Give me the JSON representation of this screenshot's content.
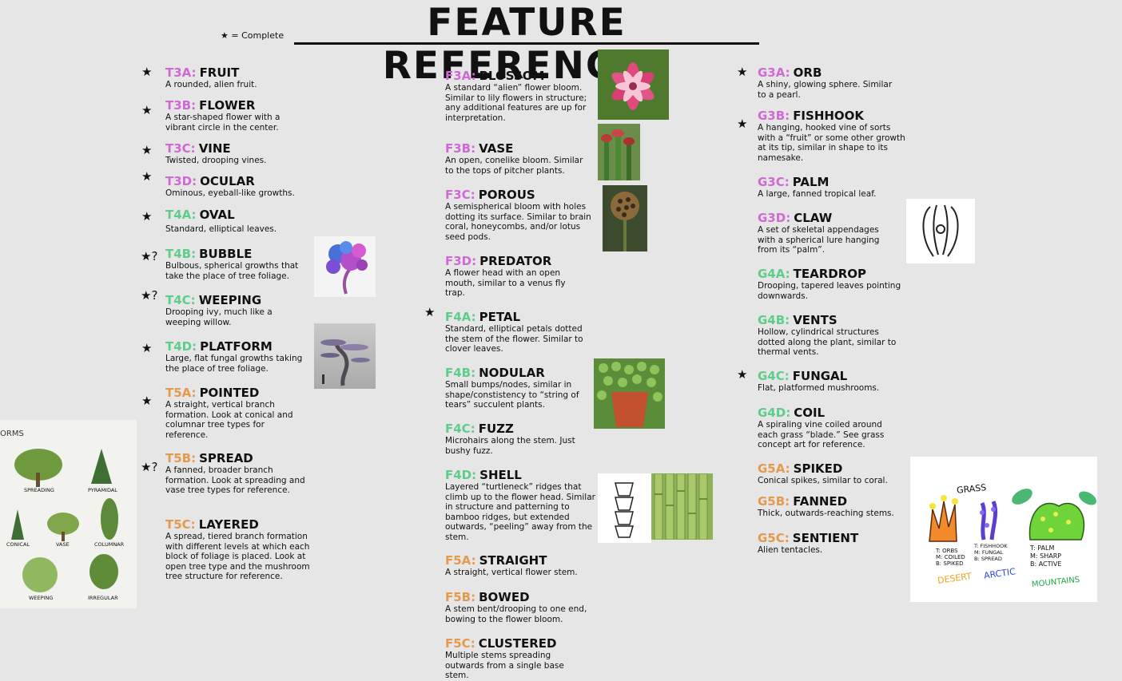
{
  "title": "FEATURE REFERENCES",
  "legend": "★ = Complete",
  "colors": {
    "pink": "#cf6ad4",
    "green": "#5fcd8a",
    "orange": "#e39a4c"
  },
  "col1": [
    {
      "code": "T3A:",
      "name": "FRUIT",
      "desc": "A rounded, alien fruit.",
      "star": "★"
    },
    {
      "code": "T3B:",
      "name": "FLOWER",
      "desc": "A star-shaped flower with a vibrant circle in the center.",
      "star": "★"
    },
    {
      "code": "T3C:",
      "name": "VINE",
      "desc": "Twisted, drooping vines.",
      "star": "★"
    },
    {
      "code": "T3D:",
      "name": "OCULAR",
      "desc": "Ominous, eyeball-like growths.",
      "star": "★"
    },
    {
      "code": "T4A:",
      "name": "OVAL",
      "desc": "Standard, elliptical leaves.",
      "star": "★"
    },
    {
      "code": "T4B:",
      "name": "BUBBLE",
      "desc": "Bulbous, spherical growths that take the place of tree foliage.",
      "star": "★?"
    },
    {
      "code": "T4C:",
      "name": "WEEPING",
      "desc": "Drooping ivy, much like a weeping willow.",
      "star": "★?"
    },
    {
      "code": "T4D:",
      "name": "PLATFORM",
      "desc": "Large, flat fungal growths taking the place of tree foliage.",
      "star": "★"
    },
    {
      "code": "T5A:",
      "name": "POINTED",
      "desc": "A straight, vertical branch formation. Look at conical and columnar tree types for reference.",
      "star": "★"
    },
    {
      "code": "T5B:",
      "name": "SPREAD",
      "desc": "A fanned, broader branch formation. Look at spreading and vase tree types for reference.",
      "star": "★?"
    },
    {
      "code": "T5C:",
      "name": "LAYERED",
      "desc": "A spread, tiered branch formation with different levels at which each block of foliage is placed. Look at open tree type and the mushroom tree structure for reference.",
      "star": ""
    }
  ],
  "col2": [
    {
      "code": "F3A:",
      "name": "BLOSSOM",
      "desc": "A standard “alien” flower bloom. Similar to lily flowers in structure; any additional features are up for interpretation.",
      "star": ""
    },
    {
      "code": "F3B:",
      "name": "VASE",
      "desc": "An open, conelike bloom. Similar to the tops of pitcher plants.",
      "star": ""
    },
    {
      "code": "F3C:",
      "name": "POROUS",
      "desc": "A semispherical bloom with holes dotting its surface. Similar to brain coral, honeycombs, and/or lotus seed pods.",
      "star": ""
    },
    {
      "code": "F3D:",
      "name": "PREDATOR",
      "desc": "A flower head with an open mouth, similar to a venus fly trap.",
      "star": ""
    },
    {
      "code": "F4A:",
      "name": "PETAL",
      "desc": "Standard, elliptical petals dotted the stem of the flower. Similar to clover leaves.",
      "star": "★"
    },
    {
      "code": "F4B:",
      "name": "NODULAR",
      "desc": "Small bumps/nodes, similar in shape/constistency to “string of tears” succulent plants.",
      "star": ""
    },
    {
      "code": "F4C:",
      "name": "FUZZ",
      "desc": "Microhairs along the stem. Just bushy fuzz.",
      "star": ""
    },
    {
      "code": "F4D:",
      "name": "SHELL",
      "desc": "Layered “turtleneck” ridges that climb up to the flower head. Similar in structure and patterning to bamboo ridges, but extended outwards, “peeling” away from the stem.",
      "star": ""
    },
    {
      "code": "F5A:",
      "name": "STRAIGHT",
      "desc": "A straight, vertical flower stem.",
      "star": ""
    },
    {
      "code": "F5B:",
      "name": "BOWED",
      "desc": "A stem bent/drooping to one end, bowing to the flower bloom.",
      "star": ""
    },
    {
      "code": "F5C:",
      "name": "CLUSTERED",
      "desc": "Multiple stems spreading outwards from a single base stem.",
      "star": ""
    }
  ],
  "col3": [
    {
      "code": "G3A:",
      "name": "ORB",
      "desc": "A shiny, glowing sphere. Similar to a pearl.",
      "star": "★"
    },
    {
      "code": "G3B:",
      "name": "FISHHOOK",
      "desc": "A hanging, hooked vine of sorts with a “fruit” or some other growth at its tip, similar in shape to its namesake.",
      "star": "★"
    },
    {
      "code": "G3C:",
      "name": "PALM",
      "desc": "A large, fanned tropical leaf.",
      "star": ""
    },
    {
      "code": "G3D:",
      "name": "CLAW",
      "desc": "A set of skeletal appendages with a spherical lure hanging from its “palm”.",
      "star": ""
    },
    {
      "code": "G4A:",
      "name": "TEARDROP",
      "desc": "Drooping, tapered leaves pointing downwards.",
      "star": ""
    },
    {
      "code": "G4B:",
      "name": "VENTS",
      "desc": "Hollow, cylindrical structures dotted along the plant, similar to thermal vents.",
      "star": ""
    },
    {
      "code": "G4C:",
      "name": "FUNGAL",
      "desc": "Flat, platformed mushrooms.",
      "star": "★"
    },
    {
      "code": "G4D:",
      "name": "COIL",
      "desc": "A spiraling vine coiled around each grass “blade.” See grass concept art for reference.",
      "star": ""
    },
    {
      "code": "G5A:",
      "name": "SPIKED",
      "desc": "Conical spikes, similar to coral.",
      "star": ""
    },
    {
      "code": "G5B:",
      "name": "FANNED",
      "desc": "Thick, outwards-reaching stems.",
      "star": ""
    },
    {
      "code": "G5C:",
      "name": "SENTIENT",
      "desc": "Alien tentacles.",
      "star": ""
    }
  ],
  "tree_forms": {
    "header": "ORMS",
    "labels": [
      "SPREADING",
      "PYRAMIDAL",
      "CONICAL",
      "VASE",
      "COLUMNAR",
      "WEEPING",
      "IRREGULAR"
    ]
  },
  "grass_art": {
    "title": "GRASS",
    "desert": {
      "lines": [
        "T: ORBS",
        "M: COILED",
        "B: SPIKED"
      ],
      "label": "DESERT"
    },
    "arctic": {
      "lines": [
        "T: FISHHOOK",
        "M: FUNGAL",
        "B: SPREAD"
      ],
      "label": "ARCTIC"
    },
    "mountains": {
      "lines": [
        "T: PALM",
        "M: SHARP",
        "B: ACTIVE"
      ],
      "label": "MOUNTAINS"
    }
  }
}
